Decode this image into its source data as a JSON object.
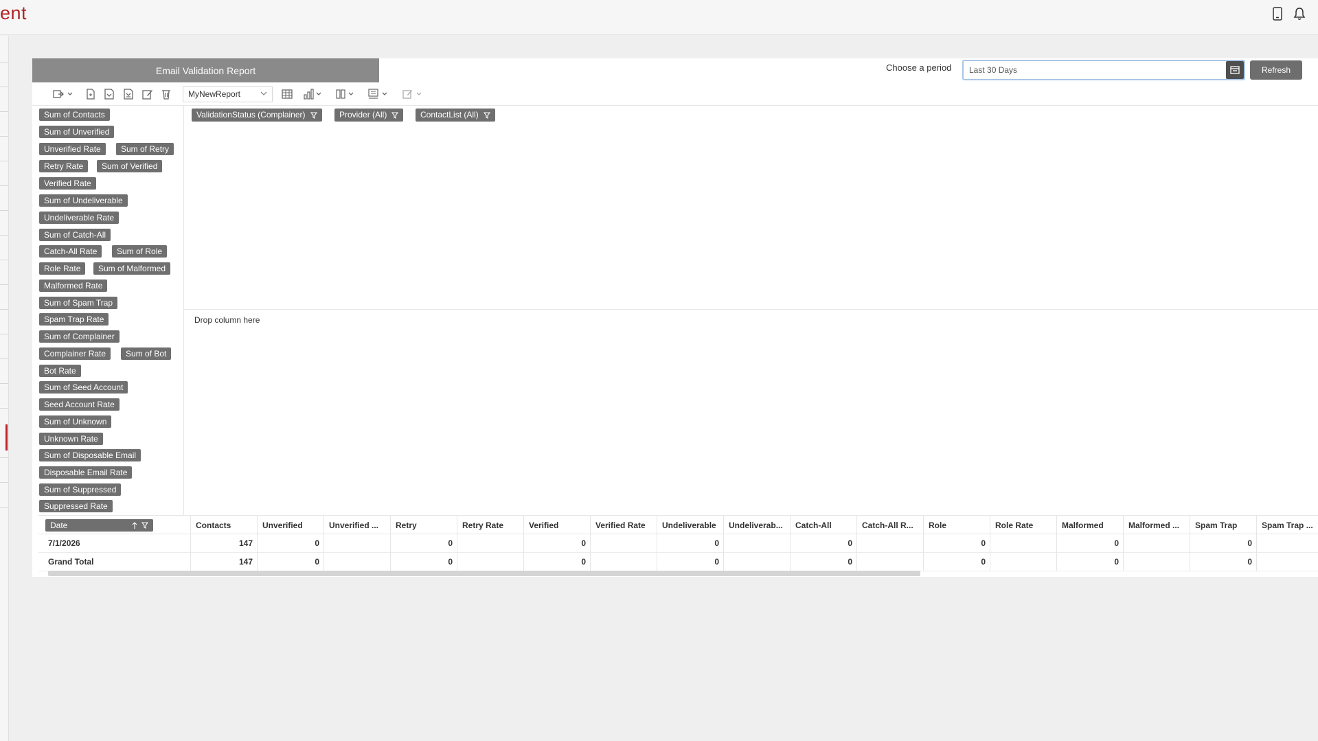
{
  "app": {
    "brand_fragment": "ent"
  },
  "header_icons": [
    "mobile-icon",
    "bell-icon"
  ],
  "report": {
    "title": "Email Validation Report"
  },
  "period": {
    "label": "Choose a period",
    "value": "Last 30 Days",
    "refresh_label": "Refresh"
  },
  "toolbar": {
    "report_name": "MyNewReport"
  },
  "fields": [
    "Sum of Contacts",
    "Sum of Unverified",
    "Unverified Rate",
    "Sum of Retry",
    "Retry Rate",
    "Sum of Verified",
    "Verified Rate",
    "Sum of Undeliverable",
    "Undeliverable Rate",
    "Sum of Catch-All",
    "Catch-All Rate",
    "Sum of Role",
    "Role Rate",
    "Sum of Malformed",
    "Malformed Rate",
    "Sum of Spam Trap",
    "Spam Trap Rate",
    "Sum of Complainer",
    "Complainer Rate",
    "Sum of Bot",
    "Bot Rate",
    "Sum of Seed Account",
    "Seed Account Rate",
    "Sum of Unknown",
    "Unknown Rate",
    "Sum of Disposable Email",
    "Disposable Email Rate",
    "Sum of Suppressed",
    "Suppressed Rate"
  ],
  "filters": [
    "ValidationStatus (Complainer)",
    "Provider (All)",
    "ContactList (All)"
  ],
  "drop_zone_label": "Drop column here",
  "grid": {
    "row_field": "Date",
    "columns": [
      "Contacts",
      "Unverified",
      "Unverified ...",
      "Retry",
      "Retry Rate",
      "Verified",
      "Verified Rate",
      "Undeliverable",
      "Undeliverab...",
      "Catch-All",
      "Catch-All R...",
      "Role",
      "Role Rate",
      "Malformed",
      "Malformed ...",
      "Spam Trap",
      "Spam Trap ..."
    ],
    "rows": [
      {
        "label": "7/1/2026",
        "values": [
          "147",
          "0",
          "",
          "0",
          "",
          "0",
          "",
          "0",
          "",
          "0",
          "",
          "0",
          "",
          "0",
          "",
          "0",
          ""
        ]
      },
      {
        "label": "Grand Total",
        "values": [
          "147",
          "0",
          "",
          "0",
          "",
          "0",
          "",
          "0",
          "",
          "0",
          "",
          "0",
          "",
          "0",
          "",
          "0",
          ""
        ]
      }
    ]
  }
}
